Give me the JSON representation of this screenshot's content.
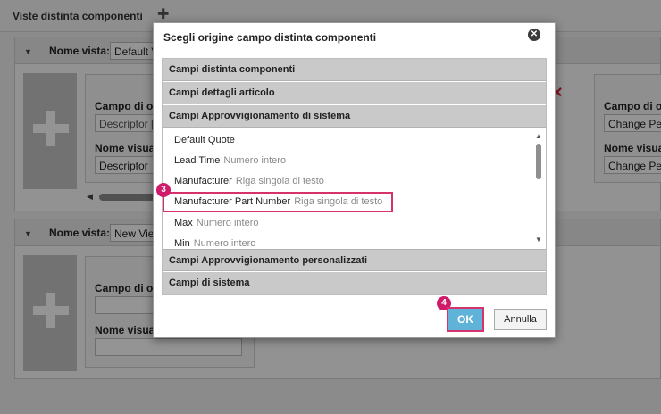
{
  "page": {
    "title": "Viste distinta componenti",
    "views": [
      {
        "name_label": "Nome vista:",
        "name_value": "Default V",
        "cards": [
          {
            "source_label": "Campo di ori",
            "source_value": "Descriptor [S",
            "display_label": "Nome visuali",
            "display_value": "Descriptor"
          },
          {
            "source_label": "Campo di ori",
            "source_value": "Change Penc",
            "display_label": "Nome visuali",
            "display_value": "Change Penc"
          }
        ]
      },
      {
        "name_label": "Nome vista:",
        "name_value": "New View",
        "cards": [
          {
            "source_label": "Campo di ori",
            "source_value": "",
            "display_label": "Nome visuali",
            "display_value": ""
          }
        ]
      }
    ]
  },
  "dialog": {
    "title": "Scegli origine campo distinta componenti",
    "groups_top": [
      "Campi distinta componenti",
      "Campi dettagli articolo",
      "Campi Approvvigionamento di sistema"
    ],
    "fields": [
      {
        "name": "Default Quote",
        "type": ""
      },
      {
        "name": "Lead Time",
        "type": "Numero intero"
      },
      {
        "name": "Manufacturer",
        "type": "Riga singola di testo"
      },
      {
        "name": "Manufacturer Part Number",
        "type": "Riga singola di testo"
      },
      {
        "name": "Max",
        "type": "Numero intero"
      },
      {
        "name": "Min",
        "type": "Numero intero"
      }
    ],
    "groups_bottom": [
      "Campi Approvvigionamento personalizzati",
      "Campi di sistema"
    ],
    "ok_label": "OK",
    "cancel_label": "Annulla"
  },
  "steps": {
    "field_step": "3",
    "ok_step": "4"
  },
  "colors": {
    "highlight": "#d6336c",
    "badge": "#d01b6a",
    "ok_button": "#5fb3d9"
  },
  "icons": {
    "add_view": "plus-icon",
    "close": "close-icon",
    "delete": "delete-x-icon"
  }
}
